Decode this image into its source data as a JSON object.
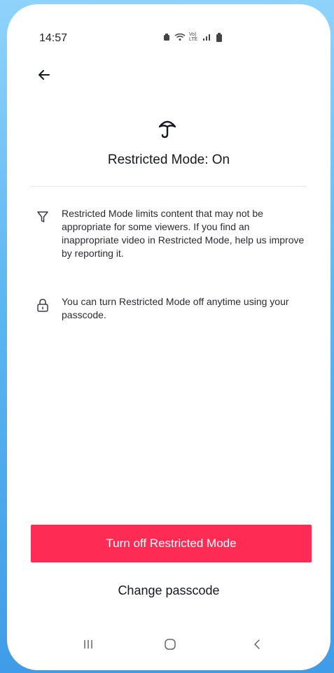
{
  "status_bar": {
    "time": "14:57",
    "icons": [
      "alarm-icon",
      "wifi-icon",
      "volte-icon",
      "signal-icon",
      "battery-icon"
    ],
    "volte_text": "Vo) LTE"
  },
  "header": {
    "back_icon": "arrow-left-icon"
  },
  "hero": {
    "icon": "umbrella-icon",
    "title": "Restricted Mode: On"
  },
  "info": [
    {
      "icon": "filter-icon",
      "text": "Restricted Mode limits content that may not be appropriate for some viewers. If you find an inappropriate video in Restricted Mode, help us improve by reporting it."
    },
    {
      "icon": "lock-icon",
      "text": "You can turn Restricted Mode off anytime using your passcode."
    }
  ],
  "actions": {
    "primary_label": "Turn off Restricted Mode",
    "secondary_label": "Change passcode"
  },
  "navigation": {
    "recents_icon": "recents-icon",
    "home_icon": "home-icon",
    "back_icon": "back-chevron-icon"
  },
  "colors": {
    "accent": "#fe2c55",
    "text": "#161823",
    "background_gradient": [
      "#8fd3fb",
      "#3f9ce8"
    ]
  }
}
